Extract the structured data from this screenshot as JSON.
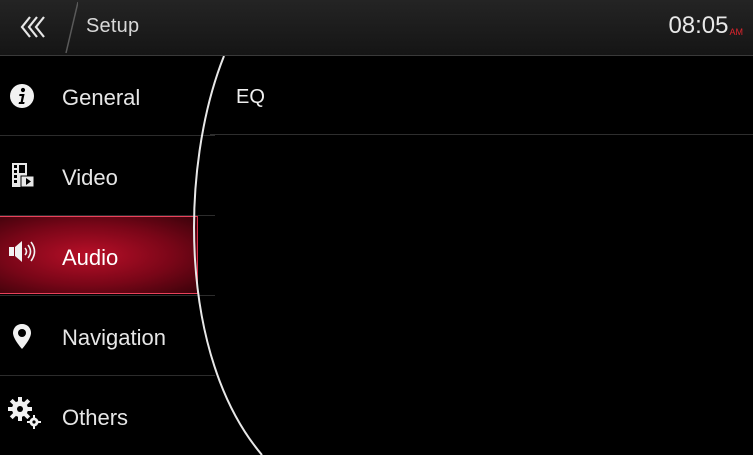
{
  "header": {
    "title": "Setup",
    "time": "08:05",
    "ampm": "AM"
  },
  "sidebar": {
    "items": [
      {
        "label": "General",
        "icon": "info-icon"
      },
      {
        "label": "Video",
        "icon": "video-icon"
      },
      {
        "label": "Audio",
        "icon": "speaker-icon",
        "active": true
      },
      {
        "label": "Navigation",
        "icon": "location-pin-icon"
      },
      {
        "label": "Others",
        "icon": "gears-icon"
      }
    ]
  },
  "main": {
    "items": [
      {
        "label": "EQ"
      }
    ]
  },
  "colors": {
    "accent": "#b80f28",
    "ampm": "#e0242d",
    "background": "#000000"
  }
}
